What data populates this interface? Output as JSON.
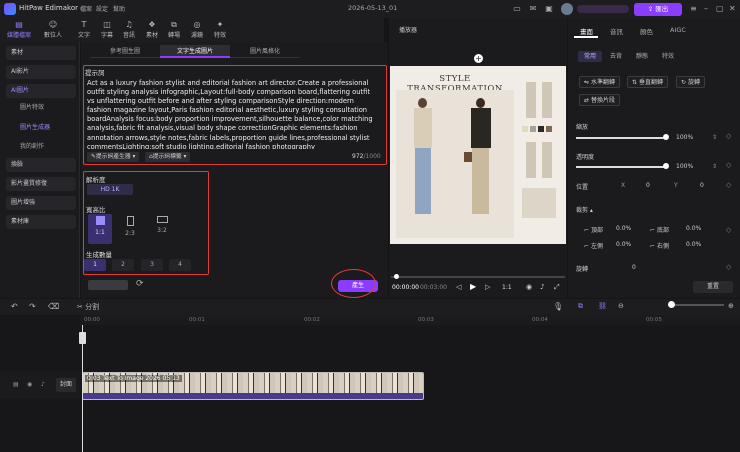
{
  "app": {
    "title": "HitPaw Edimakor",
    "project": "2026-05-13_01",
    "export_label": "匯出"
  },
  "menu": [
    "檔案",
    "設定",
    "幫助"
  ],
  "toolbar": [
    "媒體檔案",
    "數位人",
    "文字",
    "字幕",
    "音訊",
    "素材",
    "轉場",
    "濾鏡",
    "特效"
  ],
  "sidebar": {
    "items": [
      {
        "label": "素材"
      },
      {
        "label": "AI影片"
      },
      {
        "label": "AI圖片"
      },
      {
        "label": "圖片特效"
      },
      {
        "label": "圖片生成器"
      },
      {
        "label": "我的創作"
      },
      {
        "label": "換臉"
      },
      {
        "label": "影片畫質修復"
      },
      {
        "label": "圖片增強"
      },
      {
        "label": "素材庫"
      }
    ]
  },
  "panel": {
    "tabs": [
      "參考圖生圖",
      "文字生成圖片",
      "圖片風格化"
    ],
    "prompt_label": "提示詞",
    "prompt_text": "Act as a luxury fashion stylist and editorial fashion art director.Create a professional outfit styling analysis infographic,Layout:full-body comparison board,flattering outfit vs unflattering outfit before and after styling comparisonStyle direction:modern fashion magazine layout,Paris fashion editorial aesthetic,luxury styling consultation boardAnalysis focus:body proportion improvement,silhouette balance,color matching analysis,fabric fit analysis,visual body shape correctionGraphic elements:fashion annotation arrows,style notes,fabric labels,proportion guide lines,professional stylist commentsLighting:soft studio lighting,editorial fashion photography atmosphere,subtle shadowsColor palette:neutral luxury tones,cream,black,soft gray,muted earth",
    "btn_generate_prompt": "提示詞產生器",
    "btn_prompt_tags": "提示詞標籤",
    "char_count": "972",
    "char_max": "/1000",
    "resolution_label": "解析度",
    "resolution_value": "HD 1K",
    "aspect_label": "寬高比",
    "aspects": [
      "1:1",
      "2:3",
      "3:2"
    ],
    "count_label": "生成數量",
    "counts": [
      "1",
      "2",
      "3",
      "4"
    ],
    "generate_label": "產生"
  },
  "player": {
    "title": "播放器",
    "preview_heading": "STYLE TRANSFORMATION",
    "current": "00:00:00",
    "total": "00:03:00",
    "speed": "1:1"
  },
  "right": {
    "tabs": [
      "畫面",
      "音訊",
      "顏色",
      "AIGC"
    ],
    "subtabs": [
      "常用",
      "去背",
      "靜態",
      "特效"
    ],
    "buttons": [
      "水準翻轉",
      "垂直翻轉",
      "旋轉",
      "替換片段"
    ],
    "scale_label": "縮放",
    "scale_value": "100%",
    "scale_fraction": 1.0,
    "opacity_label": "透明度",
    "opacity_value": "100%",
    "opacity_fraction": 1.0,
    "position_label": "位置",
    "x_label": "X",
    "x_value": "0",
    "y_label": "Y",
    "y_value": "0",
    "crop_label": "裁剪",
    "crop": [
      {
        "label": "頂部",
        "value": "0.0%"
      },
      {
        "label": "底部",
        "value": "0.0%"
      },
      {
        "label": "左側",
        "value": "0.0%"
      },
      {
        "label": "右側",
        "value": "0.0%"
      }
    ],
    "rotate_label": "旋轉",
    "rotate_value": "0",
    "reset_label": "重置"
  },
  "timeline": {
    "split_label": "分割",
    "ticks": [
      "00:00",
      "00:01",
      "00:02",
      "00:03",
      "00:04",
      "00:05"
    ],
    "track_label": "封面",
    "clip_label": "0:03 Text To Image 2026 05 13"
  },
  "colors": {
    "accent": "#8a3dff",
    "annotation": "#e53a3a"
  }
}
